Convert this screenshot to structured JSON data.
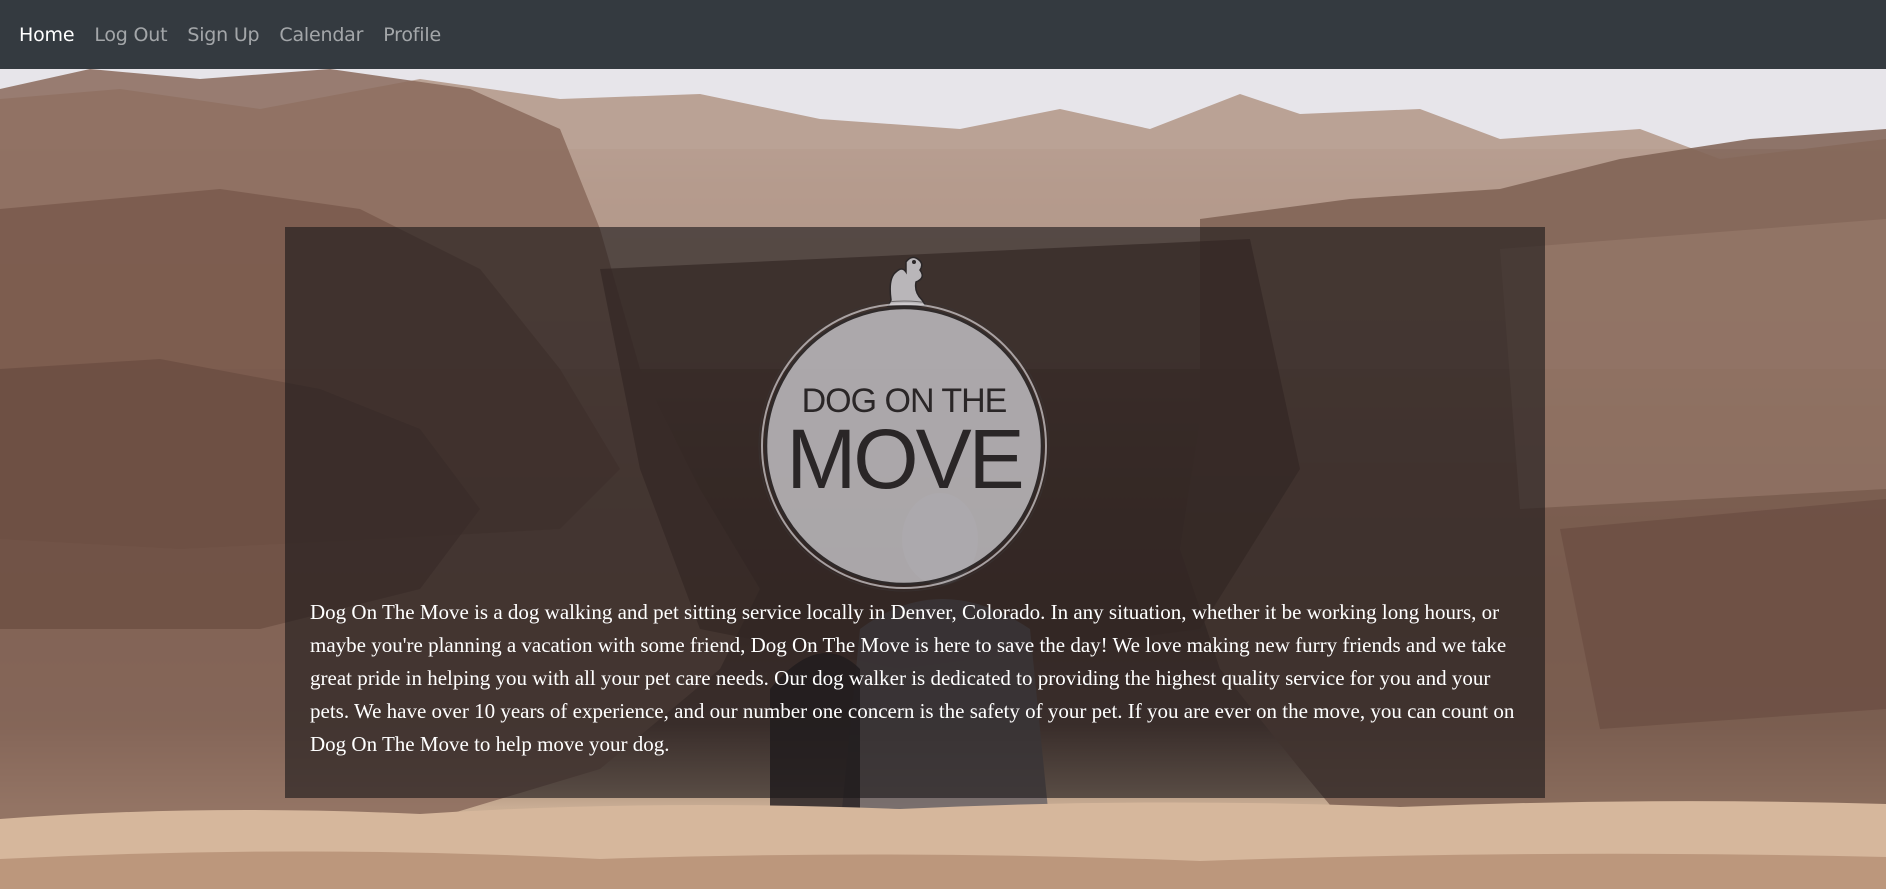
{
  "nav": {
    "items": [
      {
        "label": "Home",
        "active": true
      },
      {
        "label": "Log Out",
        "active": false
      },
      {
        "label": "Sign Up",
        "active": false
      },
      {
        "label": "Calendar",
        "active": false
      },
      {
        "label": "Profile",
        "active": false
      }
    ]
  },
  "logo": {
    "line1": "DOG ON THE",
    "line2": "MOVE",
    "icon": "dog-icon"
  },
  "about": {
    "text": "Dog On The Move is a dog walking and pet sitting service locally in Denver, Colorado. In any situation, whether it be working long hours, or maybe you're planning a vacation with some friend, Dog On The Move is here to save the day! We love making new furry friends and we take great pride in helping you with all your pet care needs. Our dog walker is dedicated to providing the highest quality service for you and your pets. We have over 10 years of experience, and our number one concern is the safety of your pet. If you are ever on the move, you can count on Dog On The Move to help move your dog."
  },
  "colors": {
    "navbar": "#343a40",
    "nav_active": "#ffffff",
    "nav_inactive": "#9a9da0",
    "overlay": "rgba(28,24,26,0.62)",
    "text": "#ffffff"
  }
}
